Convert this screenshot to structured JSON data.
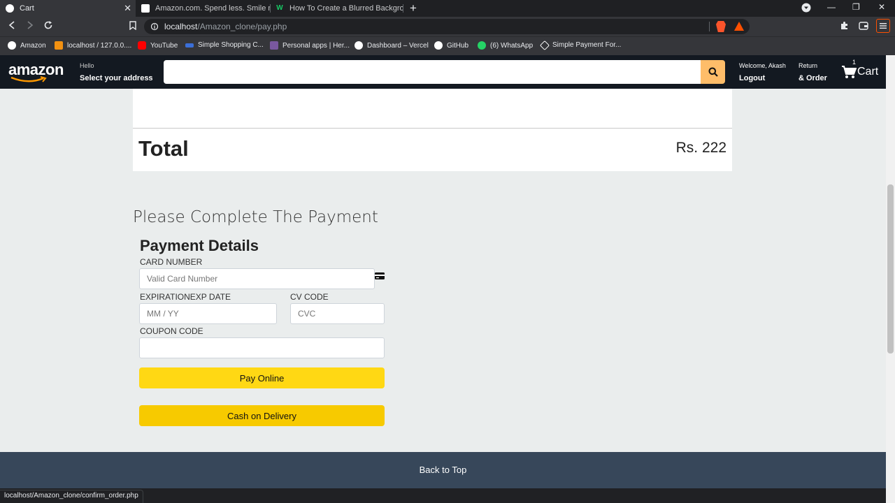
{
  "browser": {
    "tabs": [
      {
        "title": "Cart",
        "active": true
      },
      {
        "title": "Amazon.com. Spend less. Smile more.",
        "active": false
      },
      {
        "title": "How To Create a Blurred Background I",
        "active": false
      }
    ],
    "url": {
      "host": "localhost",
      "path": "/Amazon_clone/pay.php"
    },
    "bookmarks": [
      {
        "label": "Amazon",
        "color": "#ffffff"
      },
      {
        "label": "localhost / 127.0.0....",
        "color": "#f29111"
      },
      {
        "label": "YouTube",
        "color": "#ff0000"
      },
      {
        "label": "Simple Shopping C...",
        "color": "#3b6fd8"
      },
      {
        "label": "Personal apps | Her...",
        "color": "#79589f"
      },
      {
        "label": "Dashboard – Vercel",
        "color": "#ffffff"
      },
      {
        "label": "GitHub",
        "color": "#ffffff"
      },
      {
        "label": "(6) WhatsApp",
        "color": "#25d366"
      },
      {
        "label": "Simple Payment For...",
        "color": "#ffffff"
      }
    ],
    "status_url": "localhost/Amazon_clone/confirm_order.php"
  },
  "header": {
    "logo": "amazon",
    "hello": "Hello",
    "address": "Select your address",
    "welcome": "Welcome, Akash",
    "logout": "Logout",
    "return": "Return",
    "order": "& Order",
    "cart_count": "1",
    "cart_label": "Cart",
    "accent": "#febd69"
  },
  "summary": {
    "total_label": "Total",
    "total_value": "Rs. 222"
  },
  "payment": {
    "heading": "Please Complete The Payment",
    "title": "Payment Details",
    "card_label": "CARD NUMBER",
    "card_placeholder": "Valid Card Number",
    "exp_label": "EXPIRATIONEXP DATE",
    "exp_placeholder": "MM / YY",
    "cvc_label": "CV CODE",
    "cvc_placeholder": "CVC",
    "coupon_label": "COUPON CODE",
    "coupon_placeholder": "",
    "pay_online": "Pay Online",
    "cod": "Cash on Delivery"
  },
  "footer": {
    "back_to_top": "Back to Top"
  }
}
